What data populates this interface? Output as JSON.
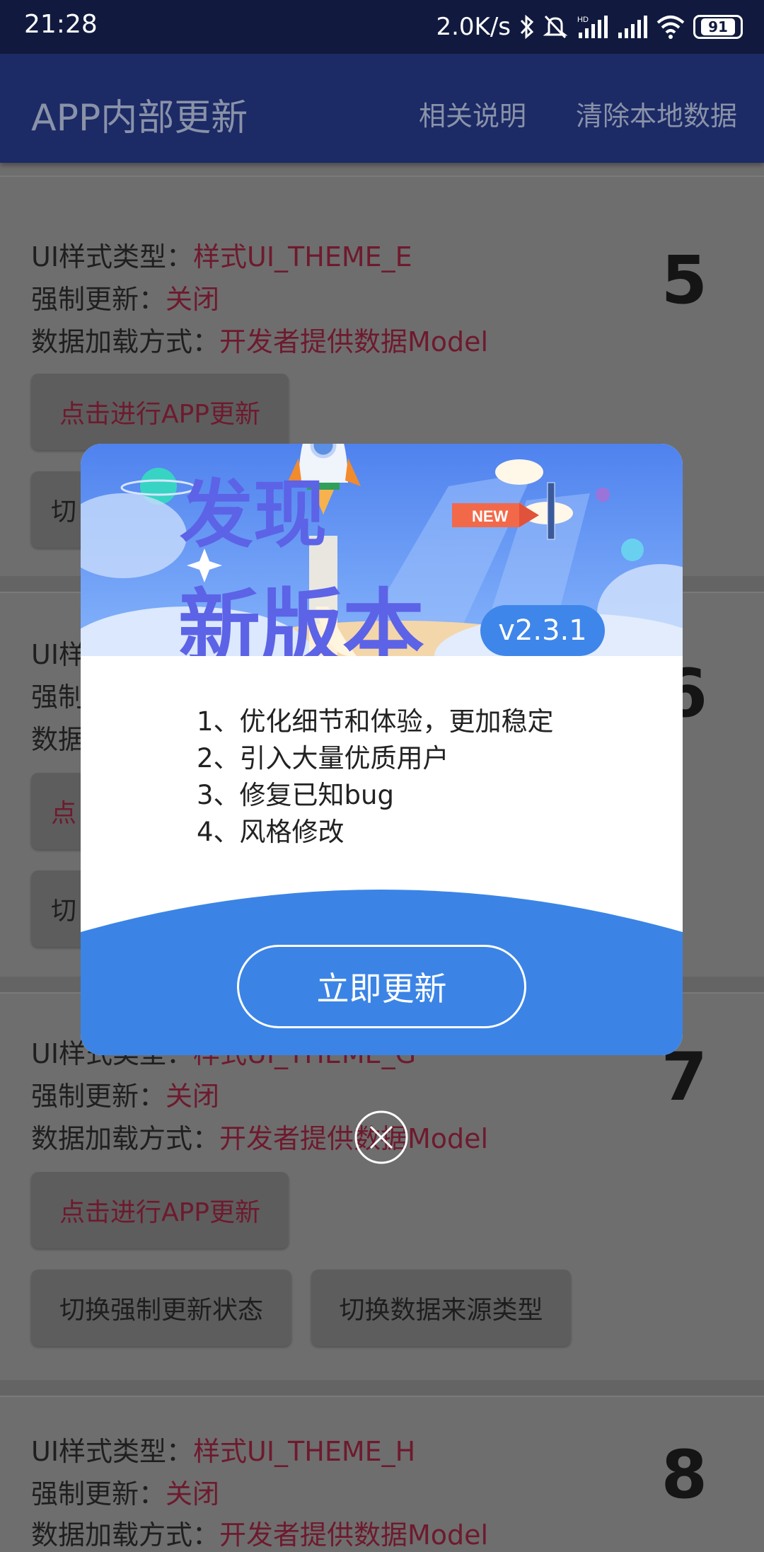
{
  "status_bar": {
    "time": "21:28",
    "net_speed": "2.0K/s",
    "battery": "91"
  },
  "app_bar": {
    "title": "APP内部更新",
    "action_help": "相关说明",
    "action_clear": "清除本地数据"
  },
  "labels": {
    "ui_type": "UI样式类型：",
    "force": "强制更新：",
    "load": "数据加载方式："
  },
  "cards": [
    {
      "number": "5",
      "ui_type_value": "样式UI_THEME_E",
      "force_value": "关闭",
      "load_value": "开发者提供数据Model",
      "update_button": "点击进行APP更新",
      "toggle_force_button": "切",
      "toggle_source_button": ""
    },
    {
      "number": "6",
      "ui_type_prefix": "UI样",
      "force_prefix": "强制",
      "load_prefix": "数据",
      "update_button": "点",
      "toggle_force_button": "切"
    },
    {
      "number": "7",
      "ui_type_value": "样式UI_THEME_G",
      "force_value": "关闭",
      "load_value": "开发者提供数据Model",
      "update_button": "点击进行APP更新",
      "toggle_force_button": "切换强制更新状态",
      "toggle_source_button": "切换数据来源类型"
    },
    {
      "number": "8",
      "ui_type_value": "样式UI_THEME_H",
      "force_value": "关闭",
      "load_value": "开发者提供数据Model"
    }
  ],
  "dialog": {
    "banner_title_line1": "发现",
    "banner_title_line2": "新版本",
    "new_tag": "NEW",
    "version": "v2.3.1",
    "notes": [
      "1、优化细节和体验，更加稳定",
      "2、引入大量优质用户",
      "3、修复已知bug",
      "4、风格修改"
    ],
    "update_button": "立即更新"
  },
  "colors": {
    "accent": "#3f86ea",
    "app_bar": "#1c2a66",
    "status_bar": "#111a3e",
    "value_text": "#6e1a2e"
  },
  "icons": [
    "bluetooth-icon",
    "mute-bell-icon",
    "hd-signal-icon",
    "signal-icon",
    "wifi-icon",
    "battery-icon",
    "rocket-icon",
    "close-icon"
  ]
}
